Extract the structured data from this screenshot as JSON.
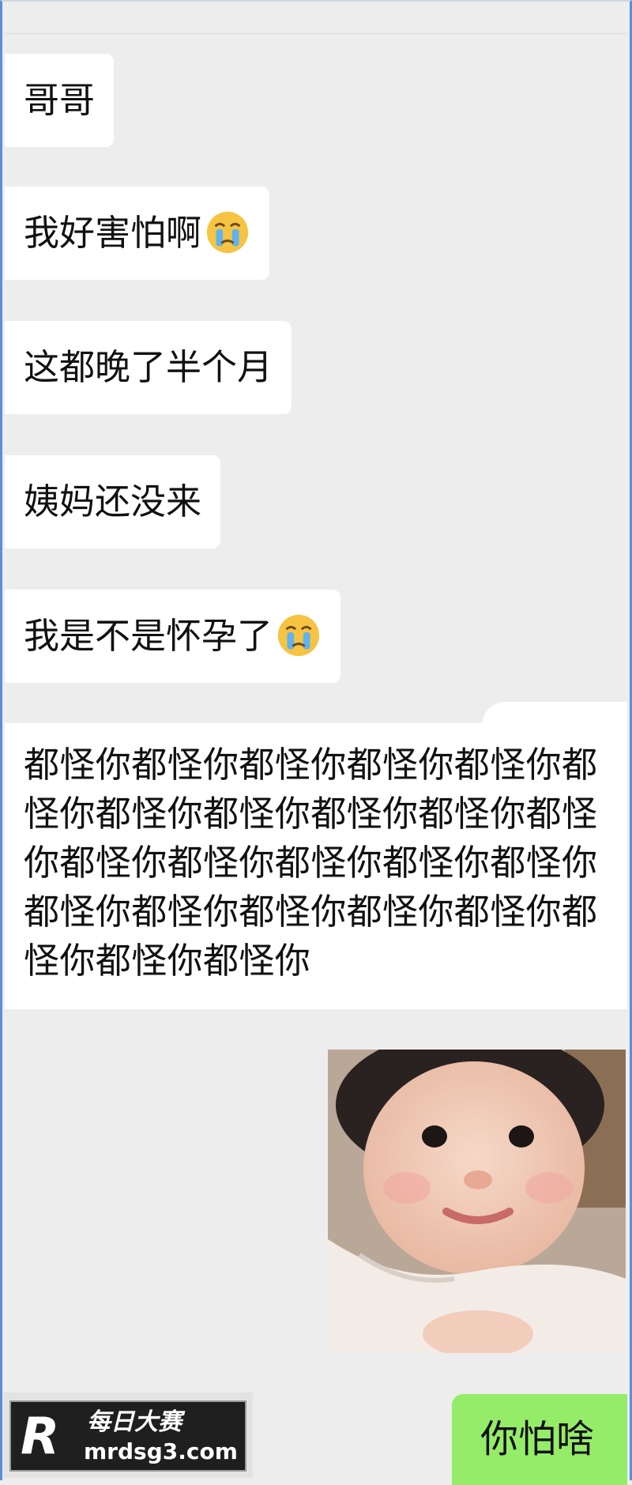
{
  "messages": [
    {
      "text": "哥哥"
    },
    {
      "text": "我好害怕啊",
      "emoji": "crying-face-icon"
    },
    {
      "text": "这都晚了半个月"
    },
    {
      "text": "姨妈还没来"
    },
    {
      "text": "我是不是怀孕了",
      "emoji": "crying-face-icon"
    }
  ],
  "long_message": "都怪你都怪你都怪你都怪你都怪你都怪你都怪你都怪你都怪你都怪你都怪你都怪你都怪你都怪你都怪你都怪你都怪你都怪你都怪你都怪你都怪你都怪你都怪你都怪你",
  "reply": "你怕啥",
  "watermark": {
    "name": "每日大赛",
    "url": "mrdsg3.com"
  },
  "colors": {
    "background": "#ededed",
    "incoming_bubble": "#ffffff",
    "outgoing_bubble": "#95ec69",
    "frame": "#5b8fd8"
  }
}
